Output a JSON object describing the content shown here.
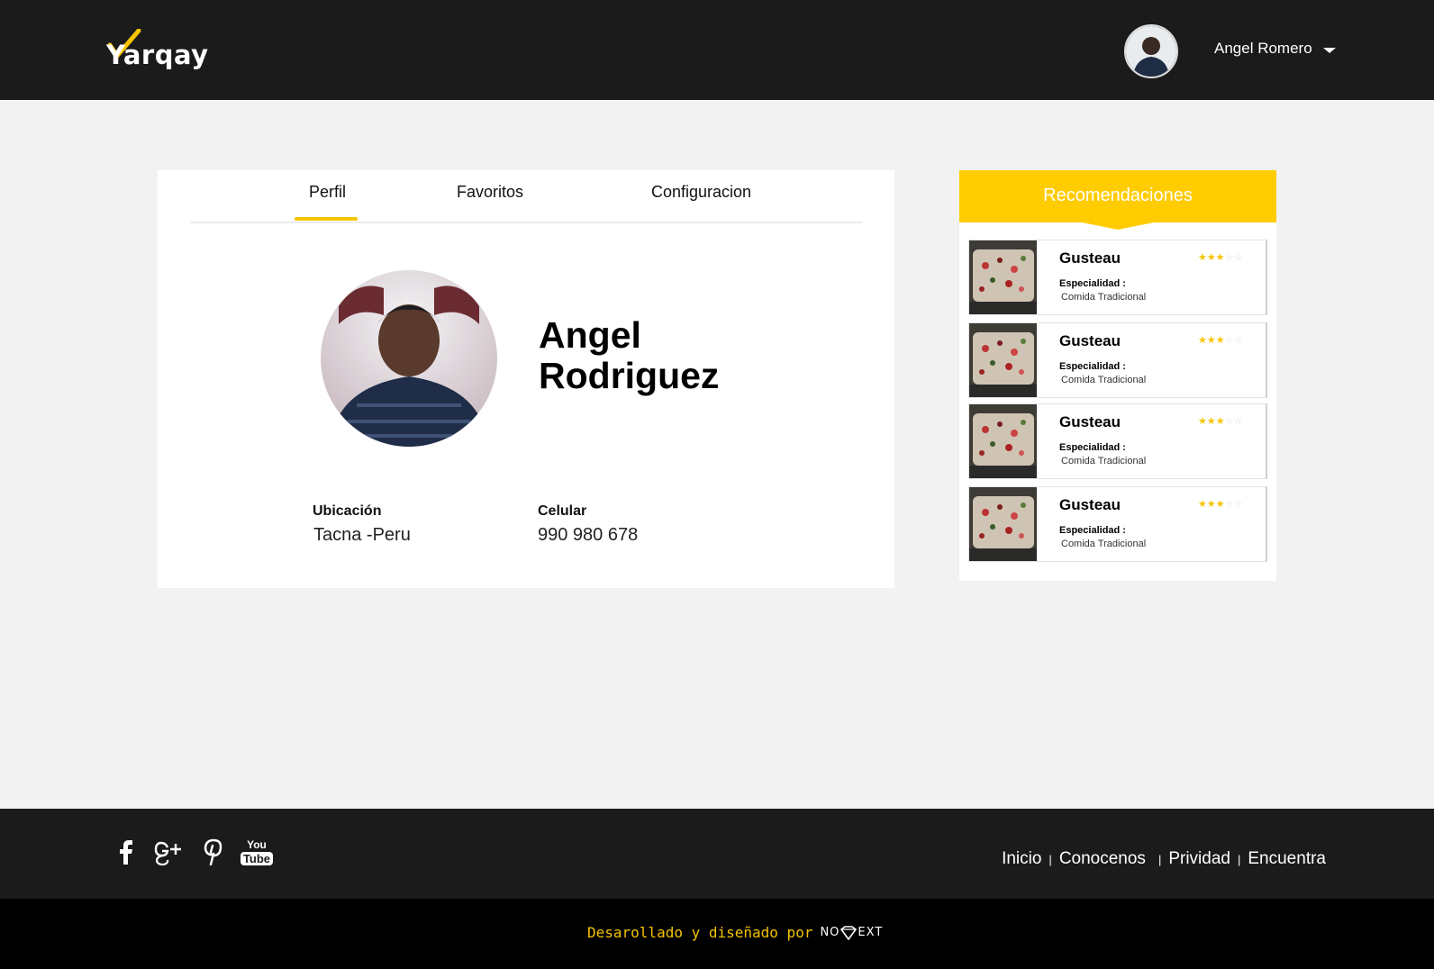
{
  "header": {
    "brand": "Yarqay",
    "user_name": "Angel Romero"
  },
  "tabs": [
    {
      "label": "Perfil",
      "active": true
    },
    {
      "label": "Favoritos",
      "active": false
    },
    {
      "label": "Configuracion",
      "active": false
    }
  ],
  "profile": {
    "first_name": "Angel",
    "last_name": "Rodriguez",
    "location_label": "Ubicación",
    "location_value": "Tacna -Peru",
    "phone_label": "Celular",
    "phone_value": "990 980 678"
  },
  "recommendations": {
    "title": "Recomendaciones",
    "items": [
      {
        "name": "Gusteau",
        "rating": 3,
        "max_rating": 5,
        "specialty_label": "Especialidad :",
        "specialty": "Comida Tradicional"
      },
      {
        "name": "Gusteau",
        "rating": 3,
        "max_rating": 5,
        "specialty_label": "Especialidad :",
        "specialty": "Comida Tradicional"
      },
      {
        "name": "Gusteau",
        "rating": 3,
        "max_rating": 5,
        "specialty_label": "Especialidad :",
        "specialty": "Comida Tradicional"
      },
      {
        "name": "Gusteau",
        "rating": 3,
        "max_rating": 5,
        "specialty_label": "Especialidad :",
        "specialty": "Comida Tradicional"
      }
    ]
  },
  "footer": {
    "social_icons": [
      "facebook-icon",
      "google-plus-icon",
      "pinterest-icon",
      "youtube-icon"
    ],
    "youtube_text_top": "You",
    "youtube_text_bottom": "Tube",
    "links": [
      "Inicio",
      "Conocenos",
      "Prividad",
      "Encuentra"
    ],
    "separator": "|",
    "credit": "Desarollado y diseñado por",
    "credit_brand_left": "NO",
    "credit_brand_right": "EXT"
  },
  "colors": {
    "accent": "#ffcc00",
    "header_bg": "#1b1b1b",
    "page_bg": "#f2f2f2"
  }
}
